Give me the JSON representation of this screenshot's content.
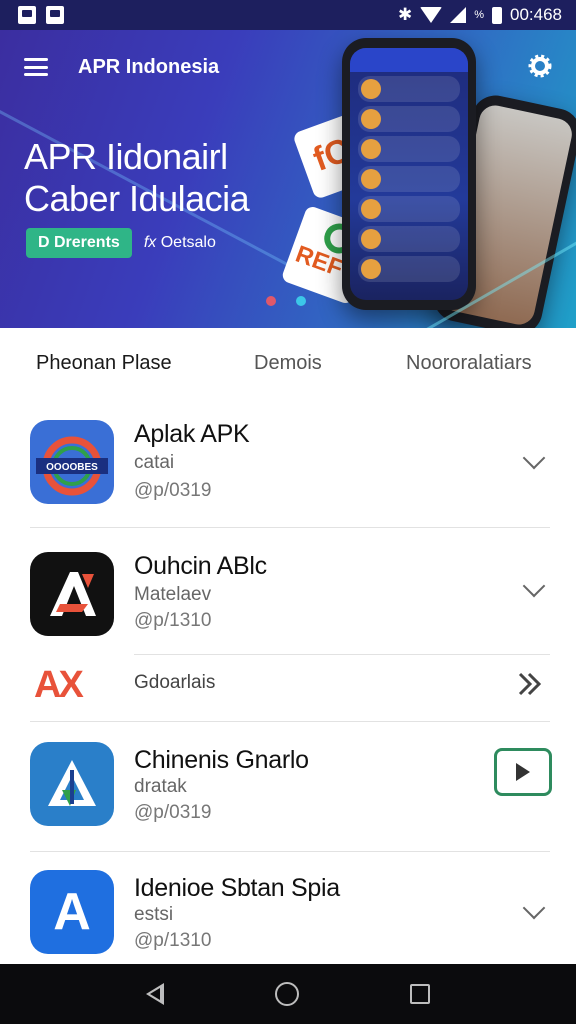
{
  "status_bar": {
    "clock": "00:468",
    "percent": "%"
  },
  "header": {
    "title": "APR Indonesia"
  },
  "hero": {
    "headline_line1": "APR Iidonairl",
    "headline_line2": "Caber Idulacia",
    "primary_button": "D Drerents",
    "secondary_link": "Oetsalo",
    "secondary_icon": "fx",
    "card1_text": "fC",
    "card2_text": "REF"
  },
  "tabs": [
    {
      "label": "Pheonan Plase",
      "active": true
    },
    {
      "label": "Demois",
      "active": false
    },
    {
      "label": "Noororalatiars",
      "active": false
    }
  ],
  "list": [
    {
      "title": "Aplak APK",
      "subtitle": "catai",
      "meta": "@p/0319",
      "action": "chevron-down"
    },
    {
      "title": "Ouhcin ABlc",
      "subtitle": "Matelaev",
      "meta": "@p/1310",
      "action": "chevron-down"
    },
    {
      "title": "Gdoarlais",
      "action": "double-chevron-right",
      "logo_text": "AX"
    },
    {
      "title": "Chinenis Gnarlo",
      "subtitle": "dratak",
      "meta": "@p/0319",
      "action": "play"
    },
    {
      "title": "Idenioe Sbtan Spia",
      "subtitle": "estsi",
      "meta": "@p/1310",
      "action": "chevron-down"
    }
  ],
  "icons": {
    "item1": {
      "name": "app-logo-icon",
      "text": "OOOOBES",
      "bg": "#3a6fd6"
    },
    "item2": {
      "name": "a-logo-icon",
      "bg": "#111111"
    },
    "item4": {
      "name": "a-arrow-icon",
      "bg": "#2a7fc9"
    },
    "item5": {
      "name": "a-letter-icon",
      "bg": "#1f6fe0",
      "text": "A"
    }
  },
  "colors": {
    "accent": "#2fb587",
    "hero_start": "#3b2ea0",
    "hero_end": "#1fa0c8"
  }
}
